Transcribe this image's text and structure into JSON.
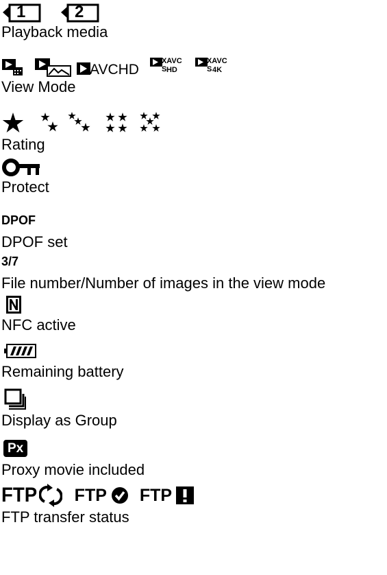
{
  "entries": [
    {
      "icons": [
        "card-slot-1-icon",
        "card-slot-2-icon"
      ],
      "slot_labels": [
        "1",
        "2"
      ],
      "description": "Playback media"
    },
    {
      "icons": [
        "view-date-icon",
        "view-still-icon",
        "view-avchd-icon",
        "view-xavcs-hd-icon",
        "view-xavcs-4k-icon"
      ],
      "icon_labels": {
        "avchd": "AVCHD",
        "xavcs": "XAVC S",
        "hd": "HD",
        "k4": "4K"
      },
      "description": "View Mode"
    },
    {
      "icons": [
        "rating-1-icon",
        "rating-2-icon",
        "rating-3-icon",
        "rating-4-icon",
        "rating-5-icon"
      ],
      "description": "Rating"
    },
    {
      "icons": [
        "protect-key-icon"
      ],
      "description": "Protect"
    },
    {
      "label": "DPOF",
      "description": "DPOF set"
    },
    {
      "label": "3/7",
      "description": "File number/Number of images in the view mode"
    },
    {
      "icons": [
        "nfc-icon"
      ],
      "description": "NFC active"
    },
    {
      "icons": [
        "battery-icon"
      ],
      "description": "Remaining battery"
    },
    {
      "icons": [
        "group-display-icon"
      ],
      "description": "Display as Group"
    },
    {
      "icons": [
        "proxy-icon"
      ],
      "icon_labels": {
        "proxy": "Px"
      },
      "description": "Proxy movie included"
    },
    {
      "icons": [
        "ftp-transferring-icon",
        "ftp-complete-icon",
        "ftp-error-icon"
      ],
      "icon_labels": {
        "ftp": "FTP"
      },
      "description": "FTP transfer status"
    }
  ]
}
